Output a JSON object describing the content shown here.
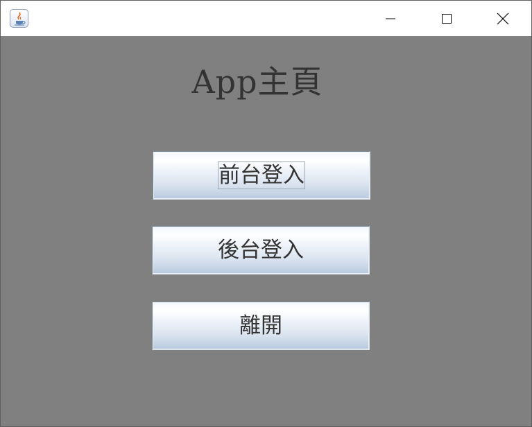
{
  "window": {
    "icon": "java-coffee-cup-icon",
    "controls": {
      "minimize": "minimize-icon",
      "maximize": "maximize-icon",
      "close": "close-icon"
    }
  },
  "main": {
    "title": "App主頁",
    "buttons": [
      {
        "label": "前台登入",
        "focused": true
      },
      {
        "label": "後台登入",
        "focused": false
      },
      {
        "label": "離開",
        "focused": false
      }
    ]
  },
  "colors": {
    "background": "#808080",
    "titlebar": "#ffffff",
    "text": "#333333"
  }
}
